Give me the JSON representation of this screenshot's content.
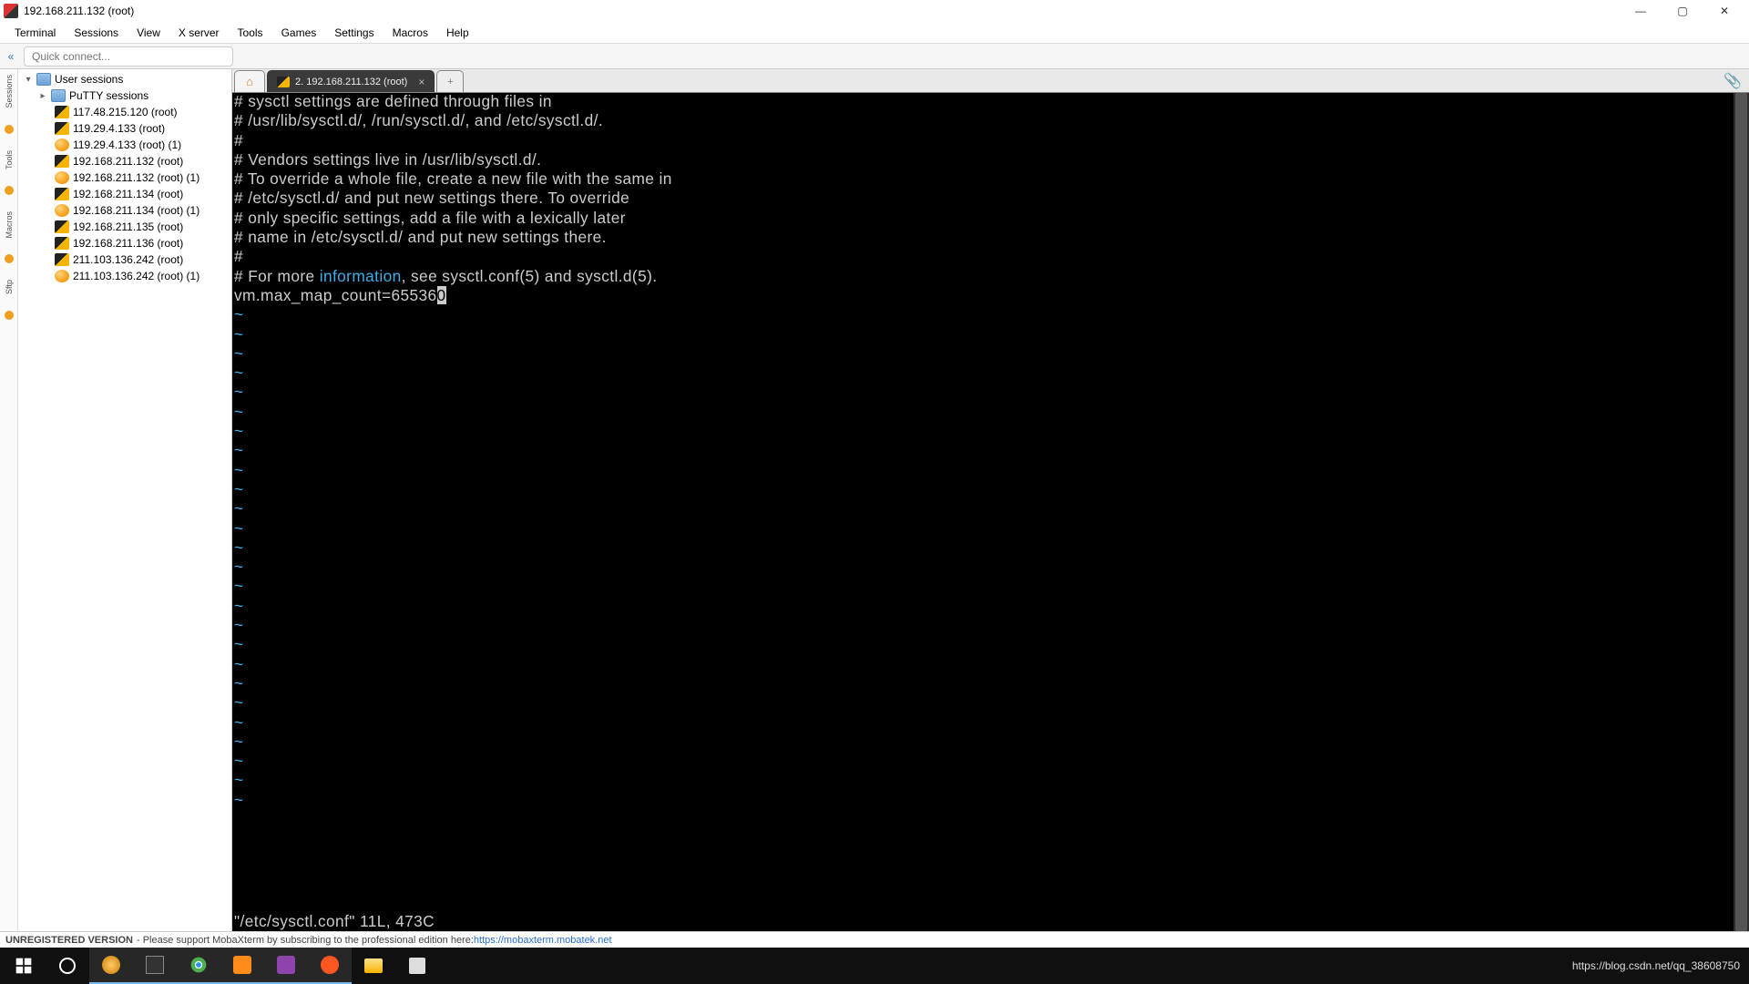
{
  "window": {
    "title": "192.168.211.132 (root)"
  },
  "menu": [
    "Terminal",
    "Sessions",
    "View",
    "X server",
    "Tools",
    "Games",
    "Settings",
    "Macros",
    "Help"
  ],
  "quick_connect": {
    "placeholder": "Quick connect..."
  },
  "vtabs": [
    "Sessions",
    "Tools",
    "Macros",
    "Sftp"
  ],
  "tree": {
    "root": "User sessions",
    "putty": "PuTTY sessions",
    "items": [
      {
        "label": "117.48.215.120 (root)",
        "icon": "term"
      },
      {
        "label": "119.29.4.133 (root)",
        "icon": "term"
      },
      {
        "label": "119.29.4.133 (root) (1)",
        "icon": "ball"
      },
      {
        "label": "192.168.211.132 (root)",
        "icon": "term"
      },
      {
        "label": "192.168.211.132 (root) (1)",
        "icon": "ball"
      },
      {
        "label": "192.168.211.134 (root)",
        "icon": "term"
      },
      {
        "label": "192.168.211.134 (root) (1)",
        "icon": "ball"
      },
      {
        "label": "192.168.211.135 (root)",
        "icon": "term"
      },
      {
        "label": "192.168.211.136 (root)",
        "icon": "term"
      },
      {
        "label": "211.103.136.242 (root)",
        "icon": "term"
      },
      {
        "label": "211.103.136.242 (root) (1)",
        "icon": "ball"
      }
    ]
  },
  "tabs": {
    "active": "2. 192.168.211.132 (root)"
  },
  "terminal": {
    "lines": [
      "# sysctl settings are defined through files in",
      "# /usr/lib/sysctl.d/, /run/sysctl.d/, and /etc/sysctl.d/.",
      "#",
      "# Vendors settings live in /usr/lib/sysctl.d/.",
      "# To override a whole file, create a new file with the same in",
      "# /etc/sysctl.d/ and put new settings there. To override",
      "# only specific settings, add a file with a lexically later",
      "# name in /etc/sysctl.d/ and put new settings there.",
      "#"
    ],
    "line_info_pre": "# For more ",
    "line_info_hl": "information",
    "line_info_post": ", see sysctl.conf(5) and sysctl.d(5).",
    "line_vm_pre": "vm.max_map_count=65536",
    "line_vm_cur": "0",
    "status": "\"/etc/sysctl.conf\" 11L, 473C"
  },
  "footer": {
    "bold": "UNREGISTERED VERSION",
    "text": " -  Please support MobaXterm by subscribing to the professional edition here: ",
    "link": "https://mobaxterm.mobatek.net"
  },
  "tray": {
    "url": "https://blog.csdn.net/qq_38608750"
  },
  "watermark": ""
}
